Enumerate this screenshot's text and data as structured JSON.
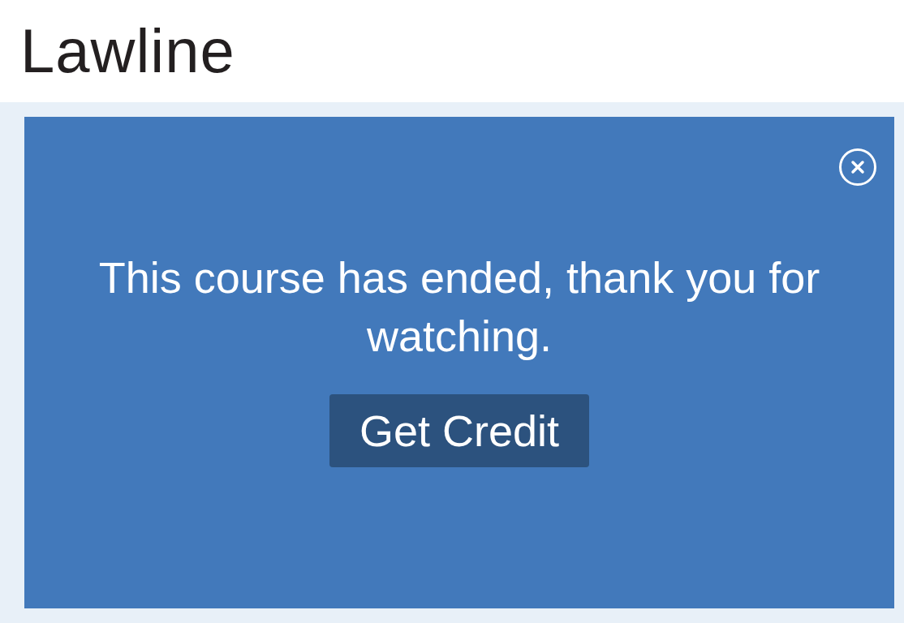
{
  "header": {
    "logo": "Lawline"
  },
  "notice": {
    "message": "This course has ended, thank you for watching.",
    "button": "Get Credit"
  }
}
